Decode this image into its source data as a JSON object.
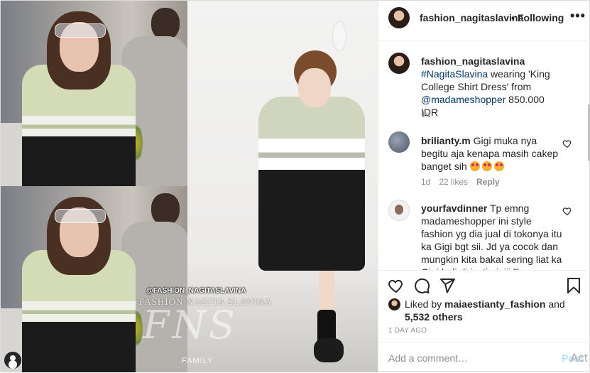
{
  "header": {
    "username": "fashion_nagitaslavina",
    "separator": "•",
    "follow_status": "Following",
    "more_icon": "more-horizontal-icon"
  },
  "caption": {
    "username": "fashion_nagitaslavina",
    "hashtag": "#NagitaSlavina",
    "text_1": " wearing 'King College Shirt Dress' from ",
    "mention": "@madameshopper",
    "text_2": " 850.000 IDR",
    "age": "1d"
  },
  "comments": [
    {
      "username": "brilianty.m",
      "text": " Gigi muka nya begitu aja kenapa masih cakep banget sih ",
      "emoji_count": 3,
      "age": "1d",
      "likes": "22 likes",
      "reply": "Reply"
    },
    {
      "username": "yourfavdinner",
      "text": " Tp emng madameshopper ini style fashion yg dia jual di tokonya itu ka Gigi bgt sii. Jd ya cocok dan mungkin kita bakal sering liat ka Gigi beli di jastip iniii:\")"
    }
  ],
  "media": {
    "watermark_handle": "@FASHION_NAGITASLAVINA",
    "watermark_name": "FASHION NAGITA SLAVINA",
    "watermark_logo": "FNS",
    "watermark_family": "FAMILY"
  },
  "actions": {
    "like_icon": "heart-icon",
    "comment_icon": "comment-icon",
    "share_icon": "share-icon",
    "save_icon": "bookmark-icon"
  },
  "likes": {
    "prefix": "Liked by ",
    "username": "maiaestianty_fashion",
    "and": " and",
    "others": "5,532 others"
  },
  "timestamp": "1 DAY AGO",
  "add_comment": {
    "placeholder": "Add a comment…",
    "post_label": "Post",
    "overlay": "Act"
  }
}
